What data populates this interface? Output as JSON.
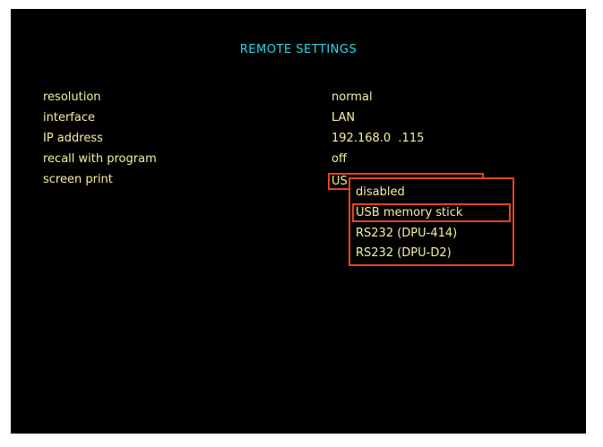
{
  "screen": {
    "title": "REMOTE SETTINGS"
  },
  "settings": [
    {
      "label": "resolution",
      "value": "normal"
    },
    {
      "label": "interface",
      "value": "LAN"
    },
    {
      "label": "IP address",
      "value": "192.168.0  .115"
    },
    {
      "label": "recall with program",
      "value": "off"
    },
    {
      "label": "screen print",
      "value": "US"
    }
  ],
  "dropdown": {
    "options": [
      "disabled",
      "USB memory stick",
      "RS232 (DPU-414)",
      "RS232 (DPU-D2)"
    ],
    "selected": "USB memory stick"
  },
  "colors": {
    "background": "#000000",
    "title": "#2fd6e6",
    "text": "#f5f0a0",
    "highlight_border": "#e2461a",
    "frame": "#ffffff"
  }
}
